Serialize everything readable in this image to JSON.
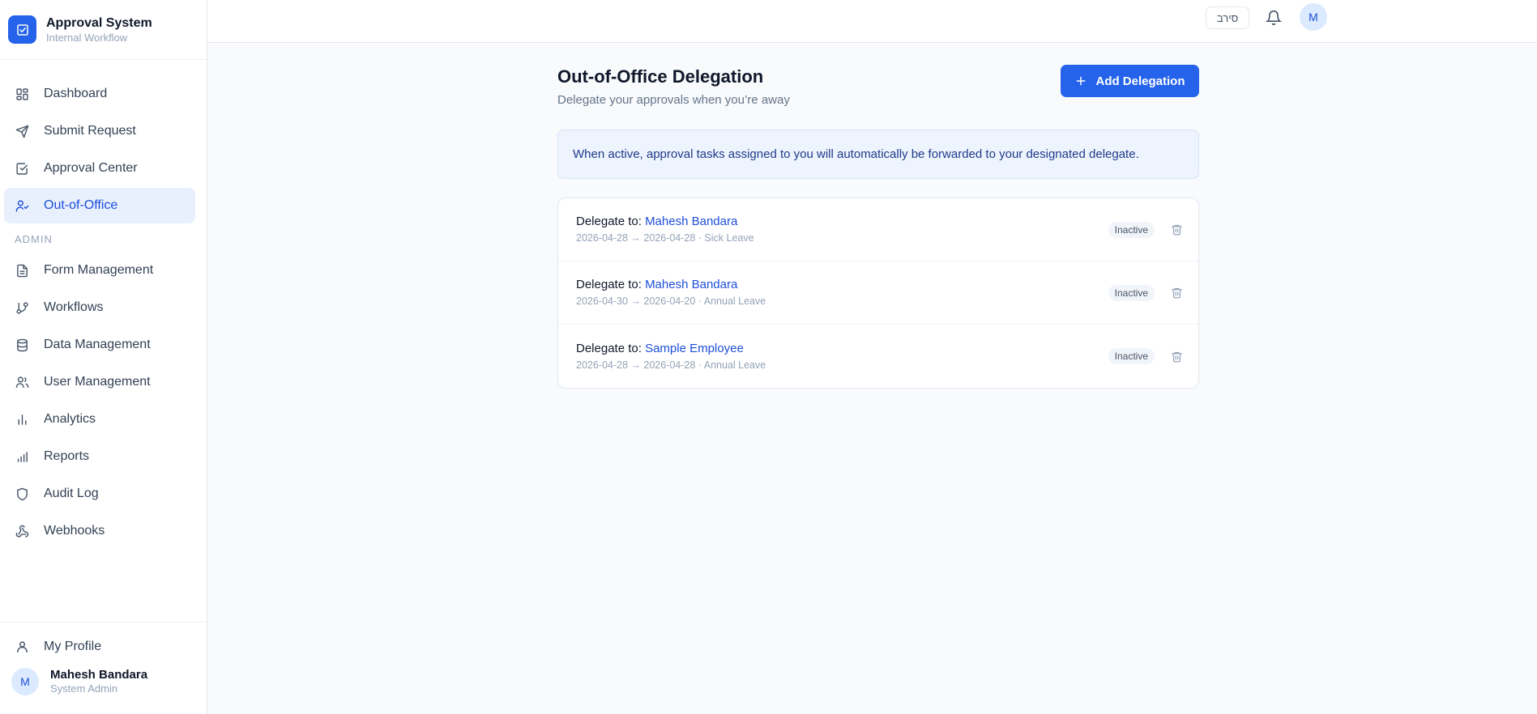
{
  "brand": {
    "title": "Approval System",
    "subtitle": "Internal Workflow",
    "accent": "#2563eb"
  },
  "sidebar": {
    "items": [
      {
        "label": "Dashboard",
        "icon": "grid-icon"
      },
      {
        "label": "Submit Request",
        "icon": "send-icon"
      },
      {
        "label": "Approval Center",
        "icon": "check-square-icon"
      },
      {
        "label": "Out-of-Office",
        "icon": "user-check-icon",
        "active": true
      }
    ],
    "admin_label": "ADMIN",
    "admin_items": [
      {
        "label": "Form Management",
        "icon": "file-text-icon"
      },
      {
        "label": "Workflows",
        "icon": "git-branch-icon"
      },
      {
        "label": "Data Management",
        "icon": "database-icon"
      },
      {
        "label": "User Management",
        "icon": "users-icon"
      },
      {
        "label": "Analytics",
        "icon": "bar-chart-icon"
      },
      {
        "label": "Reports",
        "icon": "signal-icon"
      },
      {
        "label": "Audit Log",
        "icon": "shield-icon"
      },
      {
        "label": "Webhooks",
        "icon": "webhook-icon"
      }
    ],
    "profile_link": "My Profile",
    "user": {
      "initial": "M",
      "name": "Mahesh Bandara",
      "role": "System Admin"
    }
  },
  "header": {
    "language_label": "סירב",
    "avatar_initial": "M"
  },
  "main": {
    "title": "Out-of-Office Delegation",
    "subtitle": "Delegate your approvals when you’re away",
    "add_button": "Add Delegation",
    "info": "When active, approval tasks assigned to you will automatically be forwarded to your designated delegate.",
    "delegate_prefix": "Delegate to:",
    "delegations": [
      {
        "name": "Mahesh Bandara",
        "meta": "2026-04-28 → 2026-04-28 · Sick Leave",
        "status": "Inactive"
      },
      {
        "name": "Mahesh Bandara",
        "meta": "2026-04-30 → 2026-04-20 · Annual Leave",
        "status": "Inactive"
      },
      {
        "name": "Sample Employee",
        "meta": "2026-04-28 → 2026-04-28 · Annual Leave",
        "status": "Inactive"
      }
    ]
  }
}
